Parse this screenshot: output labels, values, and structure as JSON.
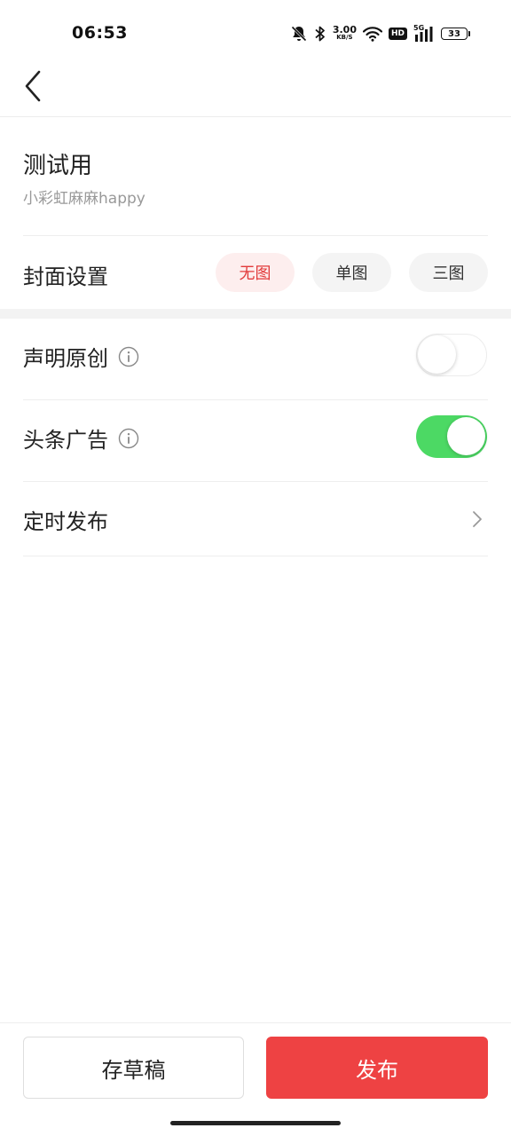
{
  "status_bar": {
    "time": "06:53",
    "net_speed_value": "3.00",
    "net_speed_unit": "KB/S",
    "hd_label": "HD",
    "network_label": "5G",
    "battery_level": "33"
  },
  "article": {
    "title": "测试用",
    "author": "小彩虹麻麻happy"
  },
  "cover": {
    "label": "封面设置",
    "options": [
      {
        "label": "无图",
        "selected": true
      },
      {
        "label": "单图",
        "selected": false
      },
      {
        "label": "三图",
        "selected": false
      }
    ]
  },
  "settings": {
    "original": {
      "label": "声明原创",
      "enabled": false
    },
    "ads": {
      "label": "头条广告",
      "enabled": true
    },
    "schedule": {
      "label": "定时发布"
    }
  },
  "actions": {
    "draft_label": "存草稿",
    "publish_label": "发布"
  },
  "colors": {
    "accent_red": "#ee4243",
    "selected_bg": "#fdeeee",
    "toggle_on": "#4cd964"
  }
}
